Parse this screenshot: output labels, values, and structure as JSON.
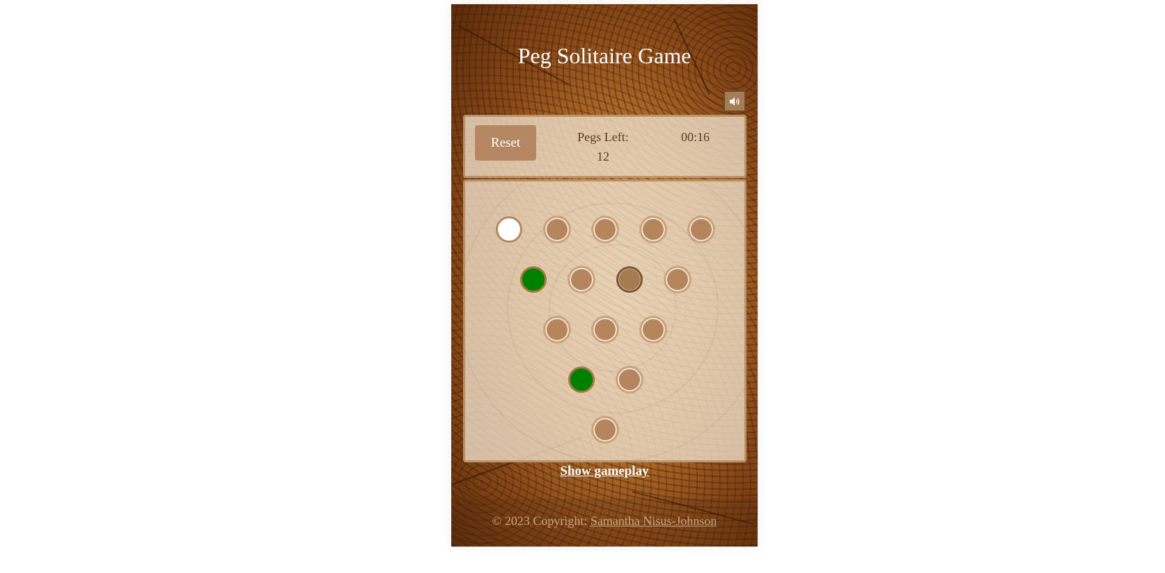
{
  "title": "Peg Solitaire Game",
  "sound_button": {
    "icon": "speaker-icon"
  },
  "controls": {
    "reset_label": "Reset",
    "pegs_left_label": "Pegs Left:",
    "pegs_left_value": "12",
    "timer": "00:16"
  },
  "board": {
    "rows": [
      [
        "empty",
        "peg",
        "peg",
        "peg",
        "peg"
      ],
      [
        "valid",
        "peg",
        "selected",
        "peg"
      ],
      [
        "peg",
        "peg",
        "peg"
      ],
      [
        "valid",
        "peg"
      ],
      [
        "peg"
      ]
    ],
    "colors": {
      "peg": "#b5865d",
      "empty": "#ffffff",
      "valid_target": "#008000"
    }
  },
  "show_gameplay": "Show gameplay",
  "footer": {
    "prefix": "© 2023 Copyright: ",
    "author": "Samantha Nisus-Johnson"
  }
}
